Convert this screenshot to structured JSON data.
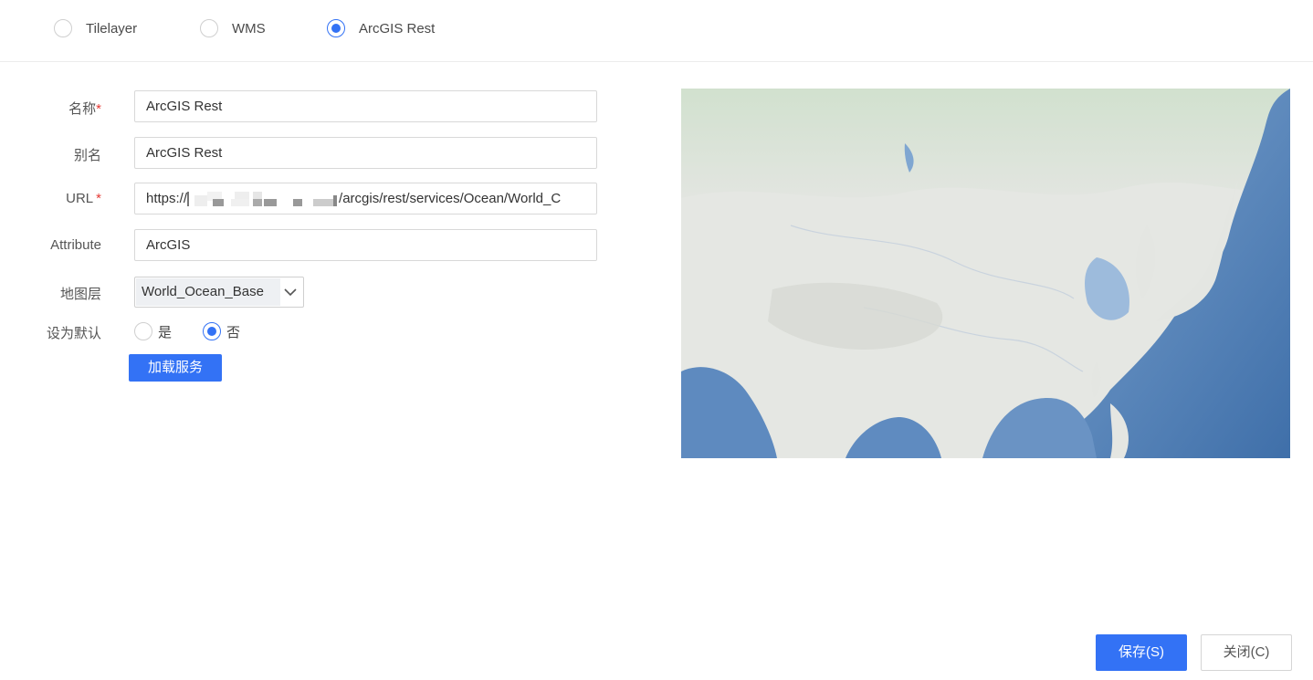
{
  "layer_types": [
    {
      "label": "Tilelayer",
      "selected": false
    },
    {
      "label": "WMS",
      "selected": false
    },
    {
      "label": "ArcGIS Rest",
      "selected": true
    }
  ],
  "form": {
    "name": {
      "label": "名称",
      "required_mark": "*",
      "value": "ArcGIS Rest"
    },
    "alias": {
      "label": "别名",
      "value": "ArcGIS Rest"
    },
    "url": {
      "label": "URL",
      "required_mark": "*",
      "value_prefix": "https://",
      "value_suffix": "/arcgis/rest/services/Ocean/World_C"
    },
    "attribute": {
      "label": "Attribute",
      "value": "ArcGIS"
    },
    "map_layer": {
      "label": "地图层",
      "selected": "World_Ocean_Base",
      "icon": "chevron-down-icon"
    },
    "set_default": {
      "label": "设为默认",
      "options": [
        {
          "label": "是",
          "selected": false
        },
        {
          "label": "否",
          "selected": true
        }
      ]
    },
    "load_button": "加载服务"
  },
  "footer": {
    "save_button": "保存(S)",
    "close_button": "关闭(C)"
  },
  "colors": {
    "primary": "#3372f5",
    "required": "#e53935",
    "map_land": "#e4e6e2",
    "map_ocean": "#5b86bd"
  }
}
